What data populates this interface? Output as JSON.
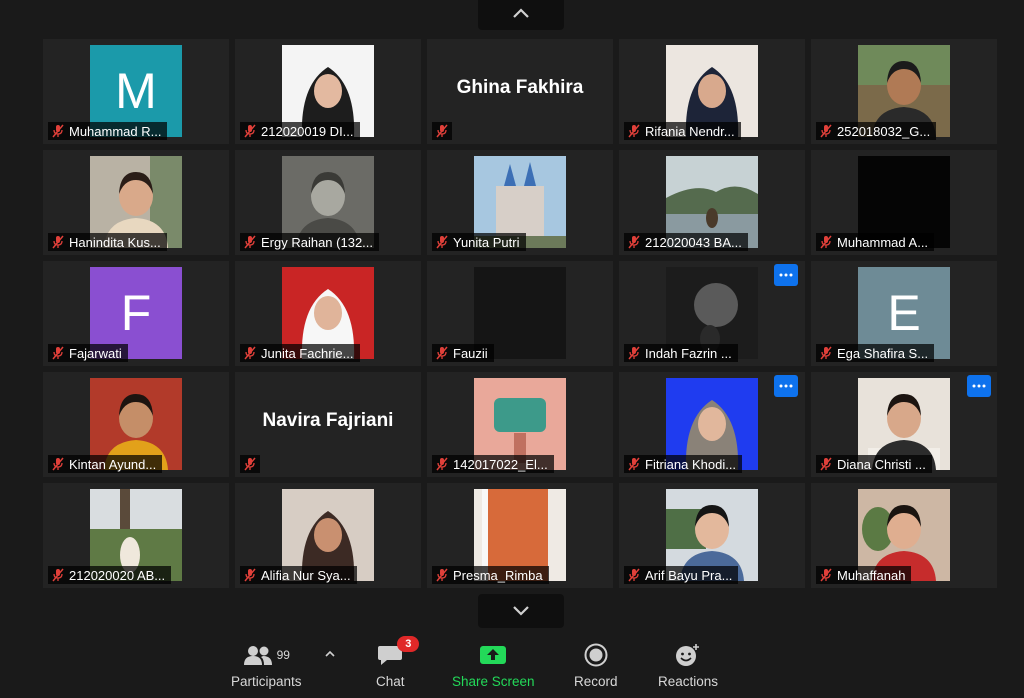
{
  "participants": [
    {
      "name": "Muhammad R...",
      "type": "letter",
      "letter": "M",
      "bg": "#1b9aaa"
    },
    {
      "name": "212020019 DI...",
      "type": "photo",
      "variant": "hijab-black"
    },
    {
      "name": "",
      "type": "name",
      "big": "Ghina Fakhira"
    },
    {
      "name": "Rifania Nendr...",
      "type": "photo",
      "variant": "hijab-navy"
    },
    {
      "name": "252018032_G...",
      "type": "photo",
      "variant": "outdoor-man"
    },
    {
      "name": "Hanindita Kus...",
      "type": "photo",
      "variant": "woman-hand"
    },
    {
      "name": "Ergy Raihan (132...",
      "type": "photo",
      "variant": "bw-portrait"
    },
    {
      "name": "Yunita Putri",
      "type": "photo",
      "variant": "castle"
    },
    {
      "name": "212020043 BA...",
      "type": "photo",
      "variant": "lake"
    },
    {
      "name": "Muhammad A...",
      "type": "photo",
      "variant": "black"
    },
    {
      "name": "Fajarwati",
      "type": "letter",
      "letter": "F",
      "bg": "#8a4fd1"
    },
    {
      "name": "Junita Fachrie...",
      "type": "photo",
      "variant": "hijab-red"
    },
    {
      "name": "Fauzii",
      "type": "photo",
      "variant": "dark"
    },
    {
      "name": "Indah Fazrin ...",
      "type": "photo",
      "variant": "dark-light",
      "more": true
    },
    {
      "name": "Ega Shafira S...",
      "type": "letter",
      "letter": "E",
      "bg": "#6e8b96"
    },
    {
      "name": "Kintan Ayund...",
      "type": "photo",
      "variant": "red-wall"
    },
    {
      "name": "",
      "type": "name",
      "big": "Navira Fajriani"
    },
    {
      "name": "142017022_El...",
      "type": "photo",
      "variant": "pink-building"
    },
    {
      "name": "Fitriana Khodi...",
      "type": "photo",
      "variant": "hijab-blue",
      "more": true
    },
    {
      "name": "Diana Christi ...",
      "type": "photo",
      "variant": "cafe",
      "more": true
    },
    {
      "name": "212020020 AB...",
      "type": "photo",
      "variant": "outdoor-tree"
    },
    {
      "name": "Alifia Nur Sya...",
      "type": "photo",
      "variant": "hijab-brown"
    },
    {
      "name": "Presma_Rimba",
      "type": "photo",
      "variant": "orange-door"
    },
    {
      "name": "Arif Bayu Pra...",
      "type": "photo",
      "variant": "denim-girl"
    },
    {
      "name": "Muhaffanah",
      "type": "photo",
      "variant": "plant-girl"
    }
  ],
  "toolbar": {
    "participants_label": "Participants",
    "participants_count": "99",
    "chat_label": "Chat",
    "chat_badge": "3",
    "share_label": "Share Screen",
    "record_label": "Record",
    "reactions_label": "Reactions"
  },
  "colors": {
    "share_green": "#23d959",
    "more_blue": "#0e72ed",
    "mute_red": "#e0403a"
  },
  "icons": {
    "page_up": "chevron-up-icon",
    "page_down": "chevron-down-icon",
    "mute": "muted-mic-icon",
    "more": "more-options-icon"
  }
}
